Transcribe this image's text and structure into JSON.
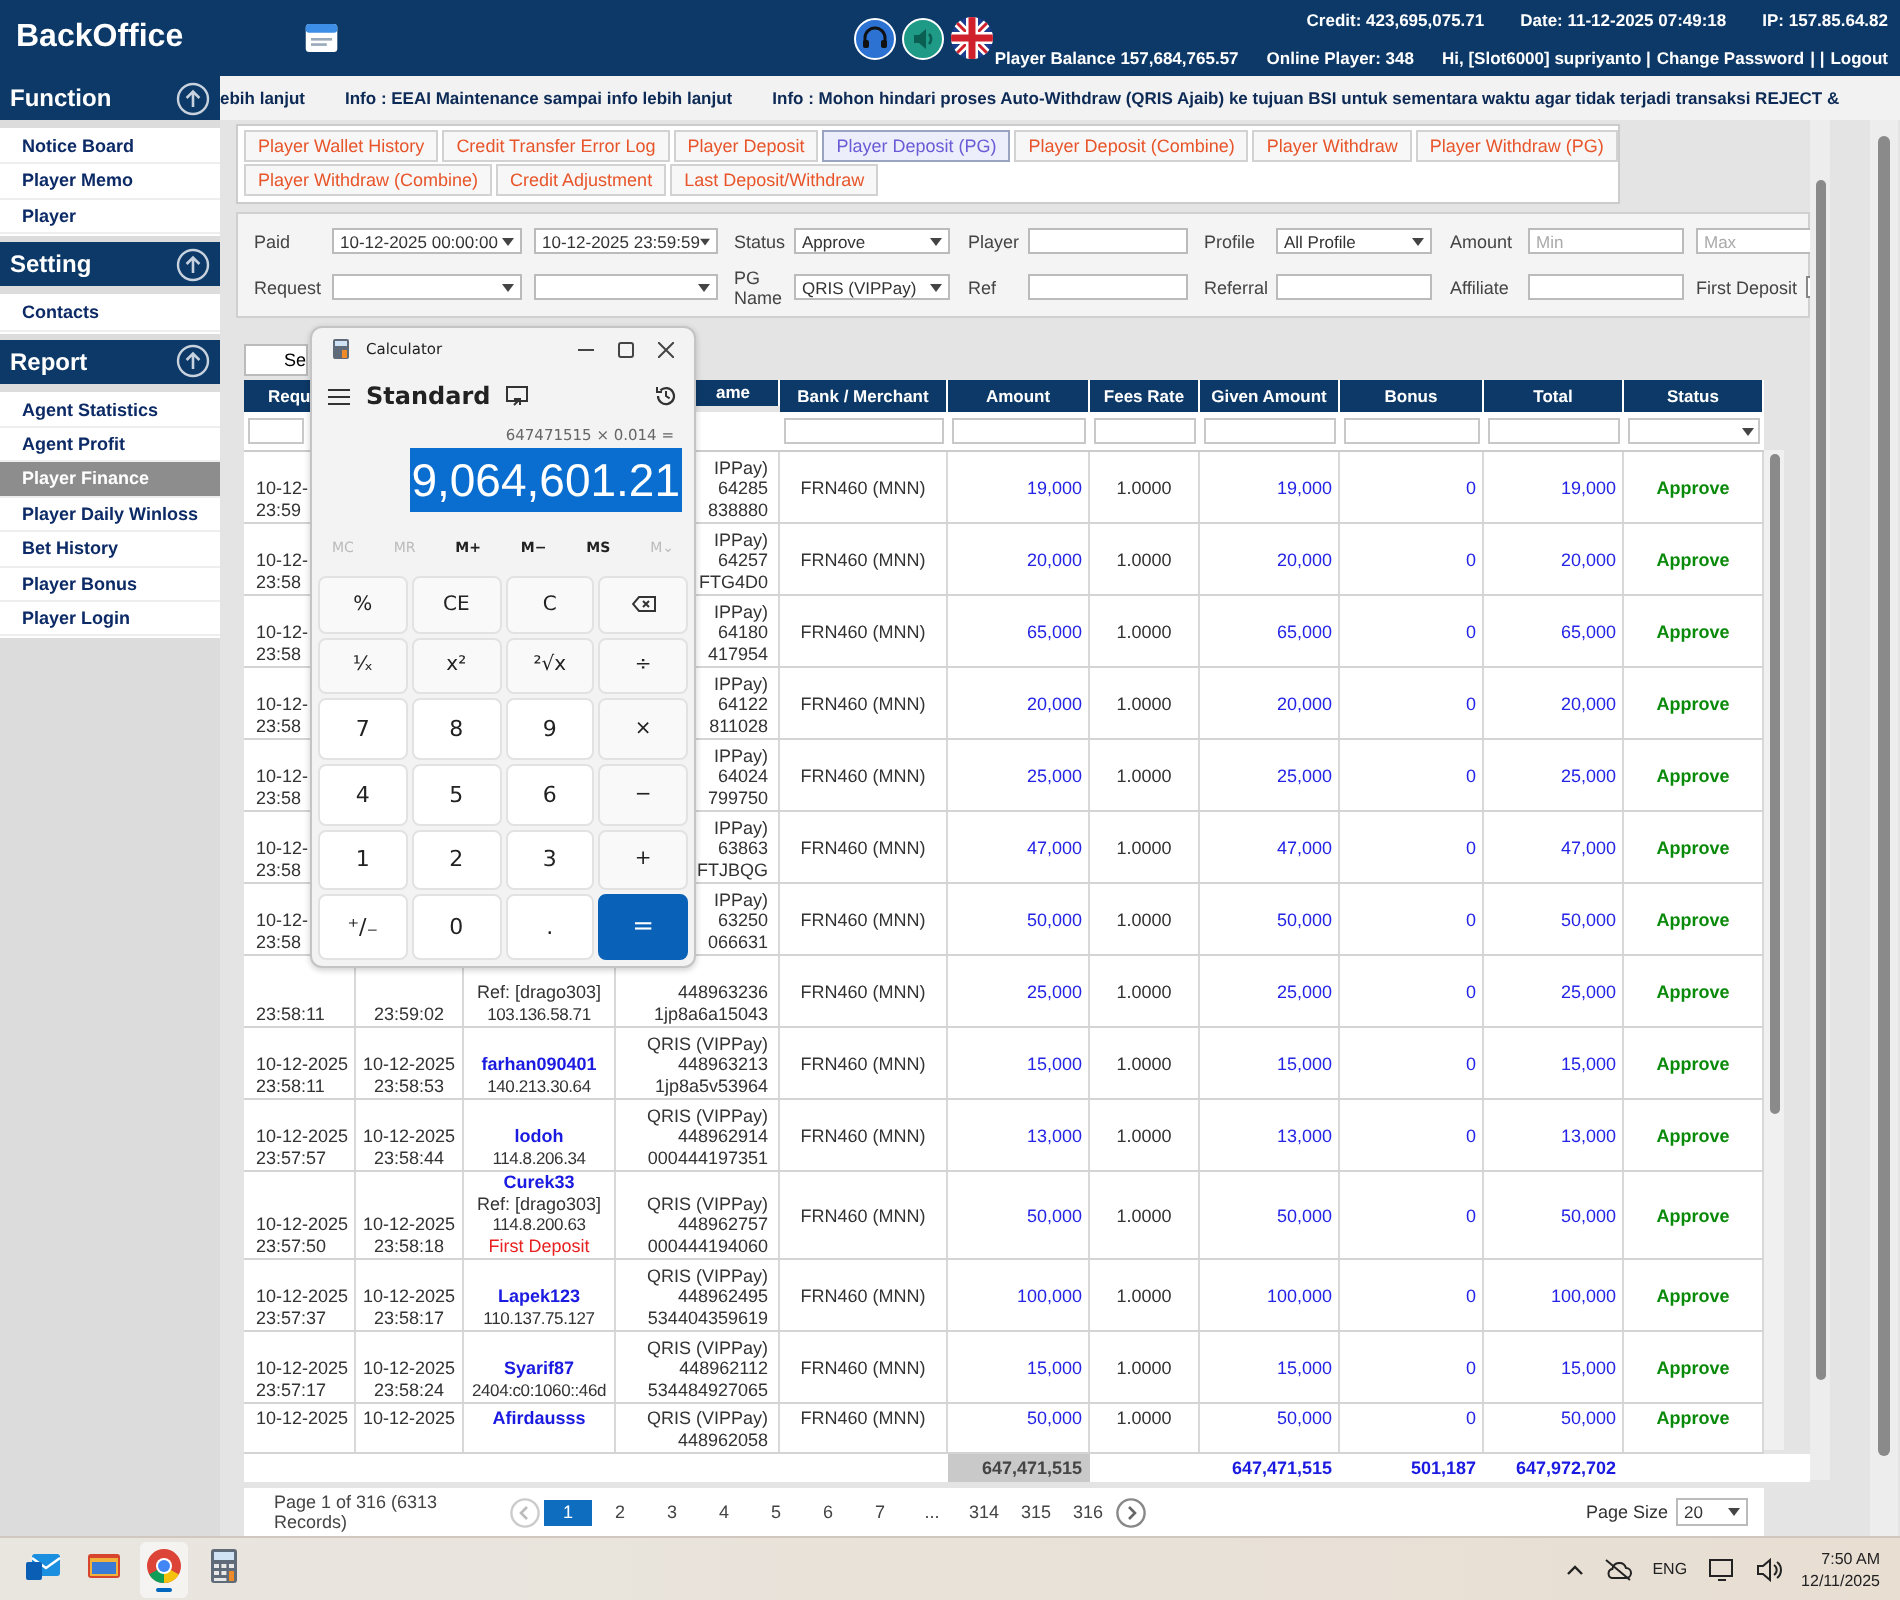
{
  "header": {
    "logo": "BackOffice",
    "top_line": [
      "Credit: 423,695,075.71",
      "Date: 11-12-2025 07:49:18",
      "IP: 157.85.64.82"
    ],
    "second_line": [
      "Player Balance 157,684,765.57",
      "Online Player: 348"
    ],
    "user": "Hi, [Slot6000] supriyanto |",
    "change_password_link": "Change Password",
    "separator": "| |",
    "logout_link": "Logout"
  },
  "sidebar": {
    "sections": [
      {
        "title": "Function",
        "items": [
          {
            "label": "Notice Board",
            "selected": false
          },
          {
            "label": "Player Memo",
            "selected": false
          },
          {
            "label": "Player",
            "selected": false
          }
        ]
      },
      {
        "title": "Setting",
        "items": [
          {
            "label": "Contacts",
            "selected": false
          }
        ]
      },
      {
        "title": "Report",
        "items": [
          {
            "label": "Agent Statistics",
            "selected": false
          },
          {
            "label": "Agent Profit",
            "selected": false
          },
          {
            "label": "Player Finance",
            "selected": true
          },
          {
            "label": "Player Daily Winloss",
            "selected": false
          },
          {
            "label": "Bet History",
            "selected": false
          },
          {
            "label": "Player Bonus",
            "selected": false
          },
          {
            "label": "Player Login",
            "selected": false
          }
        ]
      }
    ]
  },
  "marquee": [
    "ebih lanjut",
    "Info : EEAI Maintenance sampai info lebih lanjut",
    "Info : Mohon hindari proses Auto-Withdraw (QRIS Ajaib) ke tujuan BSI untuk sementara waktu agar tidak terjadi transaksi REJECT &"
  ],
  "tab_rows": [
    [
      {
        "label": "Player Wallet History",
        "selected": false
      },
      {
        "label": "Credit Transfer Error Log",
        "selected": false
      },
      {
        "label": "Player Deposit",
        "selected": false
      },
      {
        "label": "Player Deposit (PG)",
        "selected": true
      },
      {
        "label": "Player Deposit (Combine)",
        "selected": false
      },
      {
        "label": "Player Withdraw",
        "selected": false
      },
      {
        "label": "Player Withdraw (PG)",
        "selected": false
      }
    ],
    [
      {
        "label": "Player Withdraw (Combine)",
        "selected": false
      },
      {
        "label": "Credit Adjustment",
        "selected": false
      },
      {
        "label": "Last Deposit/Withdraw",
        "selected": false
      }
    ]
  ],
  "filters": [
    [
      {
        "kind": "label",
        "text": "Paid"
      },
      {
        "kind": "select",
        "value": "10-12-2025 00:00:00"
      },
      {
        "kind": "select",
        "value": "10-12-2025 23:59:59"
      },
      {
        "kind": "label",
        "text": "Status"
      },
      {
        "kind": "select",
        "value": "Approve"
      },
      {
        "kind": "label",
        "text": "Player"
      },
      {
        "kind": "input"
      },
      {
        "kind": "label",
        "text": "Profile"
      },
      {
        "kind": "select",
        "value": "All Profile"
      },
      {
        "kind": "label",
        "text": "Amount"
      },
      {
        "kind": "input",
        "placeholder": "Min"
      },
      {
        "kind": "input",
        "placeholder": "Max"
      }
    ],
    [
      {
        "kind": "label",
        "text": "Request"
      },
      {
        "kind": "select"
      },
      {
        "kind": "select"
      },
      {
        "kind": "label",
        "text": "PG Name"
      },
      {
        "kind": "select",
        "value": "QRIS (VIPPay)"
      },
      {
        "kind": "label",
        "text": "Ref"
      },
      {
        "kind": "input"
      },
      {
        "kind": "label",
        "text": "Referral"
      },
      {
        "kind": "input"
      },
      {
        "kind": "label",
        "text": "Affiliate"
      },
      {
        "kind": "input"
      },
      {
        "kind": "check",
        "text": "First Deposit",
        "checked": false
      }
    ]
  ],
  "search_button": "Se",
  "table": {
    "header": {
      "request": "Requ",
      "pg": "ame",
      "bank": "Bank / Merchant",
      "amount": "Amount",
      "fees_rate": "Fees Rate",
      "given_amount": "Given Amount",
      "bonus": "Bonus",
      "total": "Total",
      "status": "Status"
    },
    "rows": [
      {
        "request": {
          "date": "10-12-",
          "time": "23:59"
        },
        "pg": {
          "gateway": "IPPay)",
          "order_no": "64285",
          "trx_no": "838880"
        },
        "bank": "FRN460 (MNN)",
        "amount": "19,000",
        "fees_rate": "1.0000",
        "given_amount": "19,000",
        "bonus": "0",
        "total": "19,000",
        "status": "Approve"
      },
      {
        "request": {
          "date": "10-12-",
          "time": "23:58"
        },
        "pg": {
          "gateway": "IPPay)",
          "order_no": "64257",
          "trx_no": "FTG4D0"
        },
        "bank": "FRN460 (MNN)",
        "amount": "20,000",
        "fees_rate": "1.0000",
        "given_amount": "20,000",
        "bonus": "0",
        "total": "20,000",
        "status": "Approve"
      },
      {
        "request": {
          "date": "10-12-",
          "time": "23:58"
        },
        "pg": {
          "gateway": "IPPay)",
          "order_no": "64180",
          "trx_no": "417954"
        },
        "bank": "FRN460 (MNN)",
        "amount": "65,000",
        "fees_rate": "1.0000",
        "given_amount": "65,000",
        "bonus": "0",
        "total": "65,000",
        "status": "Approve"
      },
      {
        "request": {
          "date": "10-12-",
          "time": "23:58"
        },
        "pg": {
          "gateway": "IPPay)",
          "order_no": "64122",
          "trx_no": "811028"
        },
        "bank": "FRN460 (MNN)",
        "amount": "20,000",
        "fees_rate": "1.0000",
        "given_amount": "20,000",
        "bonus": "0",
        "total": "20,000",
        "status": "Approve"
      },
      {
        "request": {
          "date": "10-12-",
          "time": "23:58"
        },
        "pg": {
          "gateway": "IPPay)",
          "order_no": "64024",
          "trx_no": "799750"
        },
        "bank": "FRN460 (MNN)",
        "amount": "25,000",
        "fees_rate": "1.0000",
        "given_amount": "25,000",
        "bonus": "0",
        "total": "25,000",
        "status": "Approve"
      },
      {
        "request": {
          "date": "10-12-",
          "time": "23:58"
        },
        "pg": {
          "gateway": "IPPay)",
          "order_no": "63863",
          "trx_no": "FTJBQG"
        },
        "bank": "FRN460 (MNN)",
        "amount": "47,000",
        "fees_rate": "1.0000",
        "given_amount": "47,000",
        "bonus": "0",
        "total": "47,000",
        "status": "Approve"
      },
      {
        "request": {
          "date": "10-12-",
          "time": "23:58"
        },
        "pg": {
          "gateway": "IPPay)",
          "order_no": "63250",
          "trx_no": "066631"
        },
        "bank": "FRN460 (MNN)",
        "amount": "50,000",
        "fees_rate": "1.0000",
        "given_amount": "50,000",
        "bonus": "0",
        "total": "50,000",
        "status": "Approve"
      },
      {
        "request": {
          "time": "23:58:11"
        },
        "paid": {
          "time": "23:59:02"
        },
        "player": {
          "ref": "Ref: [drago303]",
          "ip": "103.136.58.71"
        },
        "pg": {
          "order_no": "448963236",
          "trx_no": "1jp8a6a15043"
        },
        "bank": "FRN460 (MNN)",
        "amount": "25,000",
        "fees_rate": "1.0000",
        "given_amount": "25,000",
        "bonus": "0",
        "total": "25,000",
        "status": "Approve"
      },
      {
        "request": {
          "date": "10-12-2025",
          "time": "23:58:11"
        },
        "paid": {
          "date": "10-12-2025",
          "time": "23:58:53"
        },
        "player": {
          "username": "farhan090401",
          "ip": "140.213.30.64"
        },
        "pg": {
          "gateway": "QRIS (VIPPay)",
          "order_no": "448963213",
          "trx_no": "1jp8a5v53964"
        },
        "bank": "FRN460 (MNN)",
        "amount": "15,000",
        "fees_rate": "1.0000",
        "given_amount": "15,000",
        "bonus": "0",
        "total": "15,000",
        "status": "Approve"
      },
      {
        "request": {
          "date": "10-12-2025",
          "time": "23:57:57"
        },
        "paid": {
          "date": "10-12-2025",
          "time": "23:58:44"
        },
        "player": {
          "username": "lodoh",
          "ip": "114.8.206.34"
        },
        "pg": {
          "gateway": "QRIS (VIPPay)",
          "order_no": "448962914",
          "trx_no": "000444197351"
        },
        "bank": "FRN460 (MNN)",
        "amount": "13,000",
        "fees_rate": "1.0000",
        "given_amount": "13,000",
        "bonus": "0",
        "total": "13,000",
        "status": "Approve"
      },
      {
        "request": {
          "date": "10-12-2025",
          "time": "23:57:50"
        },
        "paid": {
          "date": "10-12-2025",
          "time": "23:58:18"
        },
        "player": {
          "username": "Curek33",
          "ref": "Ref: [drago303]",
          "ip": "114.8.200.63",
          "note": "First Deposit"
        },
        "pg": {
          "gateway": "QRIS (VIPPay)",
          "order_no": "448962757",
          "trx_no": "000444194060"
        },
        "bank": "FRN460 (MNN)",
        "amount": "50,000",
        "fees_rate": "1.0000",
        "given_amount": "50,000",
        "bonus": "0",
        "total": "50,000",
        "status": "Approve"
      },
      {
        "request": {
          "date": "10-12-2025",
          "time": "23:57:37"
        },
        "paid": {
          "date": "10-12-2025",
          "time": "23:58:17"
        },
        "player": {
          "username": "Lapek123",
          "ip": "110.137.75.127"
        },
        "pg": {
          "gateway": "QRIS (VIPPay)",
          "order_no": "448962495",
          "trx_no": "534404359619"
        },
        "bank": "FRN460 (MNN)",
        "amount": "100,000",
        "fees_rate": "1.0000",
        "given_amount": "100,000",
        "bonus": "0",
        "total": "100,000",
        "status": "Approve"
      },
      {
        "request": {
          "date": "10-12-2025",
          "time": "23:57:17"
        },
        "paid": {
          "date": "10-12-2025",
          "time": "23:58:24"
        },
        "player": {
          "username": "Syarif87",
          "ip": "2404:c0:1060::46d"
        },
        "pg": {
          "gateway": "QRIS (VIPPay)",
          "order_no": "448962112",
          "trx_no": "534484927065"
        },
        "bank": "FRN460 (MNN)",
        "amount": "15,000",
        "fees_rate": "1.0000",
        "given_amount": "15,000",
        "bonus": "0",
        "total": "15,000",
        "status": "Approve"
      },
      {
        "request": {
          "date": "10-12-2025"
        },
        "paid": {
          "date": "10-12-2025"
        },
        "player": {
          "username": "Afirdausss"
        },
        "pg": {
          "gateway": "QRIS (VIPPay)",
          "order_no": "448962058"
        },
        "bank": "FRN460 (MNN)",
        "amount": "50,000",
        "fees_rate": "1.0000",
        "given_amount": "50,000",
        "bonus": "0",
        "total": "50,000",
        "status": "Approve"
      }
    ],
    "totals": {
      "amount": "647,471,515",
      "given_amount": "647,471,515",
      "bonus": "501,187",
      "total": "647,972,702"
    }
  },
  "pagination": {
    "summary": "Page 1 of 316 (6313 Records)",
    "pages": [
      {
        "label": "1",
        "selected": true
      },
      {
        "label": "2",
        "selected": false
      },
      {
        "label": "3",
        "selected": false
      },
      {
        "label": "4",
        "selected": false
      },
      {
        "label": "5",
        "selected": false
      },
      {
        "label": "6",
        "selected": false
      },
      {
        "label": "7",
        "selected": false
      },
      {
        "label": "...",
        "selected": false
      },
      {
        "label": "314",
        "selected": false
      },
      {
        "label": "315",
        "selected": false
      },
      {
        "label": "316",
        "selected": false
      }
    ],
    "page_size_label": "Page Size",
    "page_size": "20"
  },
  "calculator": {
    "title": "Calculator",
    "mode": "Standard",
    "expression": "647471515 × 0.014 =",
    "result": "9,064,601.21",
    "memory": [
      {
        "label": "MC",
        "disabled": true
      },
      {
        "label": "MR",
        "disabled": true
      },
      {
        "label": "M+",
        "disabled": false
      },
      {
        "label": "M−",
        "disabled": false
      },
      {
        "label": "MS",
        "disabled": false
      },
      {
        "label": "M⌄",
        "disabled": true
      }
    ],
    "keys": [
      {
        "kind": "op",
        "label": "%"
      },
      {
        "kind": "op",
        "label": "CE"
      },
      {
        "kind": "op",
        "label": "C"
      },
      {
        "kind": "backspace"
      },
      {
        "kind": "op",
        "label": "¹⁄ₓ"
      },
      {
        "kind": "op",
        "label": "x²"
      },
      {
        "kind": "op",
        "label": "²√x"
      },
      {
        "kind": "op",
        "label": "÷"
      },
      {
        "kind": "digit",
        "label": "7"
      },
      {
        "kind": "digit",
        "label": "8"
      },
      {
        "kind": "digit",
        "label": "9"
      },
      {
        "kind": "op",
        "label": "×"
      },
      {
        "kind": "digit",
        "label": "4"
      },
      {
        "kind": "digit",
        "label": "5"
      },
      {
        "kind": "digit",
        "label": "6"
      },
      {
        "kind": "op",
        "label": "−"
      },
      {
        "kind": "digit",
        "label": "1"
      },
      {
        "kind": "digit",
        "label": "2"
      },
      {
        "kind": "digit",
        "label": "3"
      },
      {
        "kind": "op",
        "label": "+"
      },
      {
        "kind": "digit",
        "label": "⁺/₋"
      },
      {
        "kind": "digit",
        "label": "0"
      },
      {
        "kind": "digit",
        "label": "."
      },
      {
        "kind": "equals",
        "label": "="
      }
    ]
  },
  "taskbar": {
    "apps": [
      {
        "kind": "mail",
        "active": false
      },
      {
        "kind": "folder",
        "active": false
      },
      {
        "kind": "browser",
        "active": true
      },
      {
        "kind": "calculator",
        "active": false
      }
    ],
    "language": "ENG",
    "time": "7:50 AM",
    "date": "12/11/2025"
  }
}
